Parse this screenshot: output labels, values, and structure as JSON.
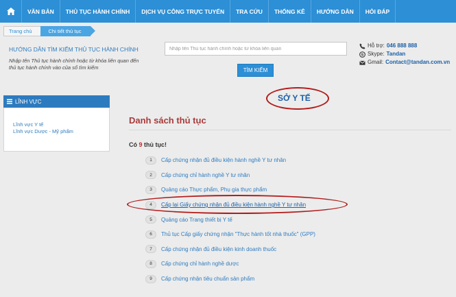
{
  "nav": {
    "items": [
      {
        "label": "VĂN BẢN"
      },
      {
        "label": "THỦ TỤC HÀNH CHÍNH"
      },
      {
        "label": "DỊCH VỤ CÔNG TRỰC TUYẾN"
      },
      {
        "label": "TRA CỨU"
      },
      {
        "label": "THỐNG KÊ"
      },
      {
        "label": "HƯỚNG DẪN"
      },
      {
        "label": "HỎI ĐÁP"
      }
    ],
    "color": "#2d8fd5"
  },
  "breadcrumb": {
    "home": "Trang chủ",
    "current": "Chi tiết thủ tục"
  },
  "search": {
    "title": "HƯỚNG DẪN TÌM KIẾM THỦ TỤC HÀNH CHÍNH",
    "description": "Nhập tên Thủ tục hành chính hoặc từ khóa liên quan đến thủ tục hành chính vào của sổ tìm kiếm",
    "placeholder": "Nhập tên Thủ tục hành chính hoặc từ khóa liên quan",
    "button": "TÌM KIẾM"
  },
  "support": {
    "hotline_label": "Hỗ trợ:",
    "hotline": "046 888 888",
    "skype_label": "Skype:",
    "skype": "Tandan",
    "gmail_label": "Gmail:",
    "gmail": "Contact@tandan.com.vn"
  },
  "sidebar": {
    "title": "LĨNH VỰC",
    "items": [
      {
        "label": "Lĩnh vực Y tế"
      },
      {
        "label": "Lĩnh vực Dược - Mỹ phẩm"
      }
    ]
  },
  "main": {
    "org": "SỞ Y TẾ",
    "heading": "Danh sách thủ tục",
    "count_prefix": "Có",
    "count": "9",
    "count_suffix": "thủ tục!",
    "procedures": [
      {
        "num": "1",
        "label": "Cấp chứng nhận đủ điều kiện hành nghề Y tư nhân"
      },
      {
        "num": "2",
        "label": "Cấp chứng chỉ hành nghề Y tư nhân"
      },
      {
        "num": "3",
        "label": "Quảng cáo Thực phẩm, Phụ gia thực phẩm"
      },
      {
        "num": "4",
        "label": "Cấp lại Giấy chứng nhận đủ điều kiện hành nghề Y tư nhân"
      },
      {
        "num": "5",
        "label": "Quảng cáo Trang thiết bị Y tế"
      },
      {
        "num": "6",
        "label": "Thủ tục Cấp giấy chứng nhận \"Thực hành tốt nhà thuốc\" (GPP)"
      },
      {
        "num": "7",
        "label": "Cấp chứng nhận đủ điều kiện kinh doanh thuốc"
      },
      {
        "num": "8",
        "label": "Cấp chứng chỉ hành nghề dược"
      },
      {
        "num": "9",
        "label": "Cấp chứng nhận tiêu chuẩn sản phẩm"
      }
    ]
  },
  "colors": {
    "accent": "#2d8fd5",
    "heading": "#a83a3a",
    "highlight_oval": "#b31b1b",
    "link": "#2d7bbf"
  }
}
